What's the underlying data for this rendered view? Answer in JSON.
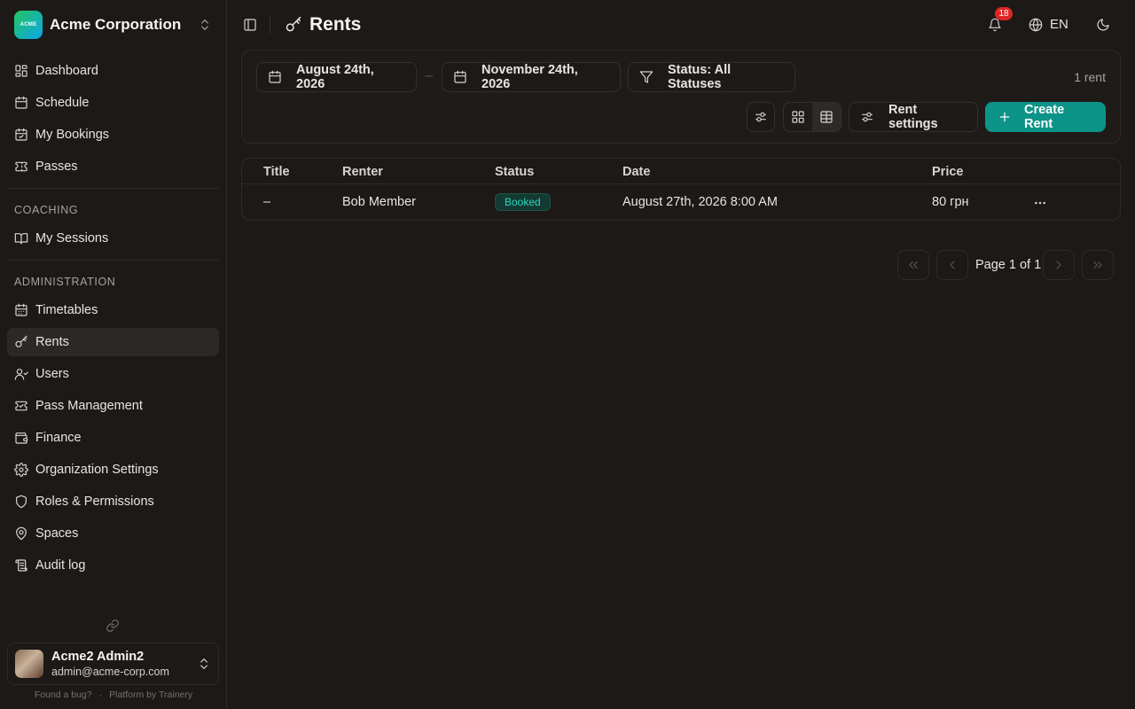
{
  "org": {
    "name": "Acme Corporation",
    "logo_text": "ACME"
  },
  "nav": {
    "main": [
      {
        "label": "Dashboard",
        "icon": "dashboard-icon"
      },
      {
        "label": "Schedule",
        "icon": "calendar-icon"
      },
      {
        "label": "My Bookings",
        "icon": "calendar-check-icon"
      },
      {
        "label": "Passes",
        "icon": "ticket-icon"
      }
    ],
    "coaching_label": "COACHING",
    "coaching": [
      {
        "label": "My Sessions",
        "icon": "book-open-icon"
      }
    ],
    "admin_label": "ADMINISTRATION",
    "admin": [
      {
        "label": "Timetables",
        "icon": "calendar-days-icon"
      },
      {
        "label": "Rents",
        "icon": "key-icon"
      },
      {
        "label": "Users",
        "icon": "users-icon"
      },
      {
        "label": "Pass Management",
        "icon": "ticket-icon"
      },
      {
        "label": "Finance",
        "icon": "wallet-icon"
      },
      {
        "label": "Organization Settings",
        "icon": "gear-icon"
      },
      {
        "label": "Roles & Permissions",
        "icon": "shield-icon"
      },
      {
        "label": "Spaces",
        "icon": "map-pin-icon"
      },
      {
        "label": "Audit log",
        "icon": "audit-log-icon"
      }
    ],
    "active": "Rents"
  },
  "user": {
    "name": "Acme2 Admin2",
    "email": "admin@acme-corp.com"
  },
  "footer": {
    "bug": "Found a bug?",
    "separator": "·",
    "platform": "Platform by Trainery"
  },
  "header": {
    "title": "Rents",
    "notification_count": "18",
    "language": "EN"
  },
  "filters": {
    "date_from": "August 24th, 2026",
    "date_to": "November 24th, 2026",
    "date_separator": "–",
    "status": "Status: All Statuses",
    "count": "1 rent",
    "rent_settings": "Rent settings",
    "create": "Create Rent"
  },
  "table": {
    "columns": [
      "Title",
      "Renter",
      "Status",
      "Date",
      "Price"
    ],
    "rows": [
      {
        "title": "–",
        "renter": "Bob Member",
        "status": "Booked",
        "date": "August 27th, 2026 8:00 AM",
        "price": "80 грн"
      }
    ]
  },
  "pagination": {
    "label": "Page 1 of 1"
  },
  "colors": {
    "accent": "#0d9488",
    "background": "#1c1917",
    "badge": "#dc2626",
    "status_booked": "#2dd4bf"
  }
}
